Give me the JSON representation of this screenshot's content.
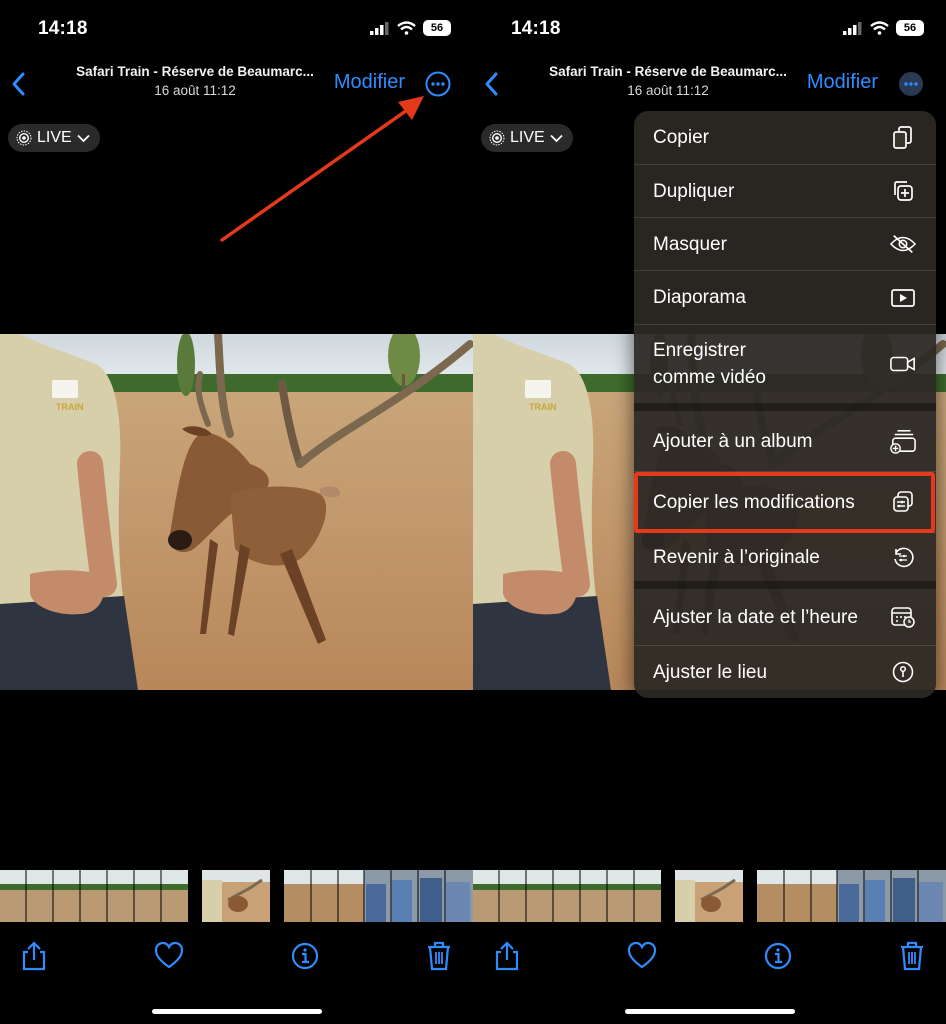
{
  "status": {
    "time": "14:18",
    "battery": "56"
  },
  "nav": {
    "title": "Safari Train - Réserve de Beaumarc...",
    "subtitle": "16 août  11:12",
    "edit_label": "Modifier"
  },
  "live_badge": {
    "label": "LIVE"
  },
  "menu": {
    "items": [
      {
        "label": "Copier",
        "icon": "copy-icon"
      },
      {
        "label": "Dupliquer",
        "icon": "duplicate-icon"
      },
      {
        "label": "Masquer",
        "icon": "eye-slash-icon"
      },
      {
        "label": "Diaporama",
        "icon": "slideshow-icon"
      },
      {
        "label": "Enregistrer comme vidéo",
        "label_line1": "Enregistrer",
        "label_line2": "comme vidéo",
        "icon": "video-camera-icon"
      },
      {
        "label": "Ajouter à un album",
        "icon": "add-to-album-icon"
      },
      {
        "label": "Copier les modifications",
        "icon": "copy-edits-icon"
      },
      {
        "label": "Revenir à l’originale",
        "icon": "revert-icon"
      },
      {
        "label": "Ajuster la date et l’heure",
        "icon": "calendar-clock-icon"
      },
      {
        "label": "Ajuster le lieu",
        "icon": "location-info-icon"
      }
    ]
  },
  "toolbar": {
    "icons": [
      "share-icon",
      "heart-icon",
      "info-icon",
      "trash-icon"
    ]
  },
  "colors": {
    "accent": "#2f8cff",
    "highlight": "#e5391c",
    "arrow": "#e5391c"
  }
}
